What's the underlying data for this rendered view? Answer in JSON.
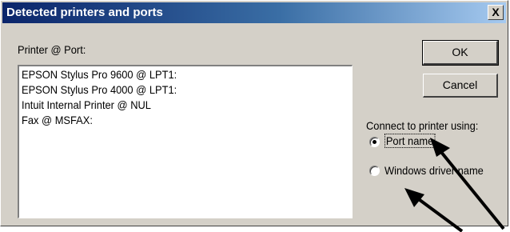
{
  "window": {
    "title": "Detected printers and ports",
    "close_label": "X"
  },
  "list": {
    "header_label": "Printer @ Port:",
    "items": [
      "EPSON Stylus Pro 9600 @ LPT1:",
      "EPSON Stylus Pro 4000 @ LPT1:",
      "Intuit Internal Printer @ NUL",
      "Fax @ MSFAX:"
    ]
  },
  "buttons": {
    "ok_label": "OK",
    "cancel_label": "Cancel"
  },
  "connect": {
    "label": "Connect to printer using:",
    "options": [
      {
        "label": "Port name",
        "selected": true
      },
      {
        "label": "Windows driver name",
        "selected": false
      }
    ]
  }
}
